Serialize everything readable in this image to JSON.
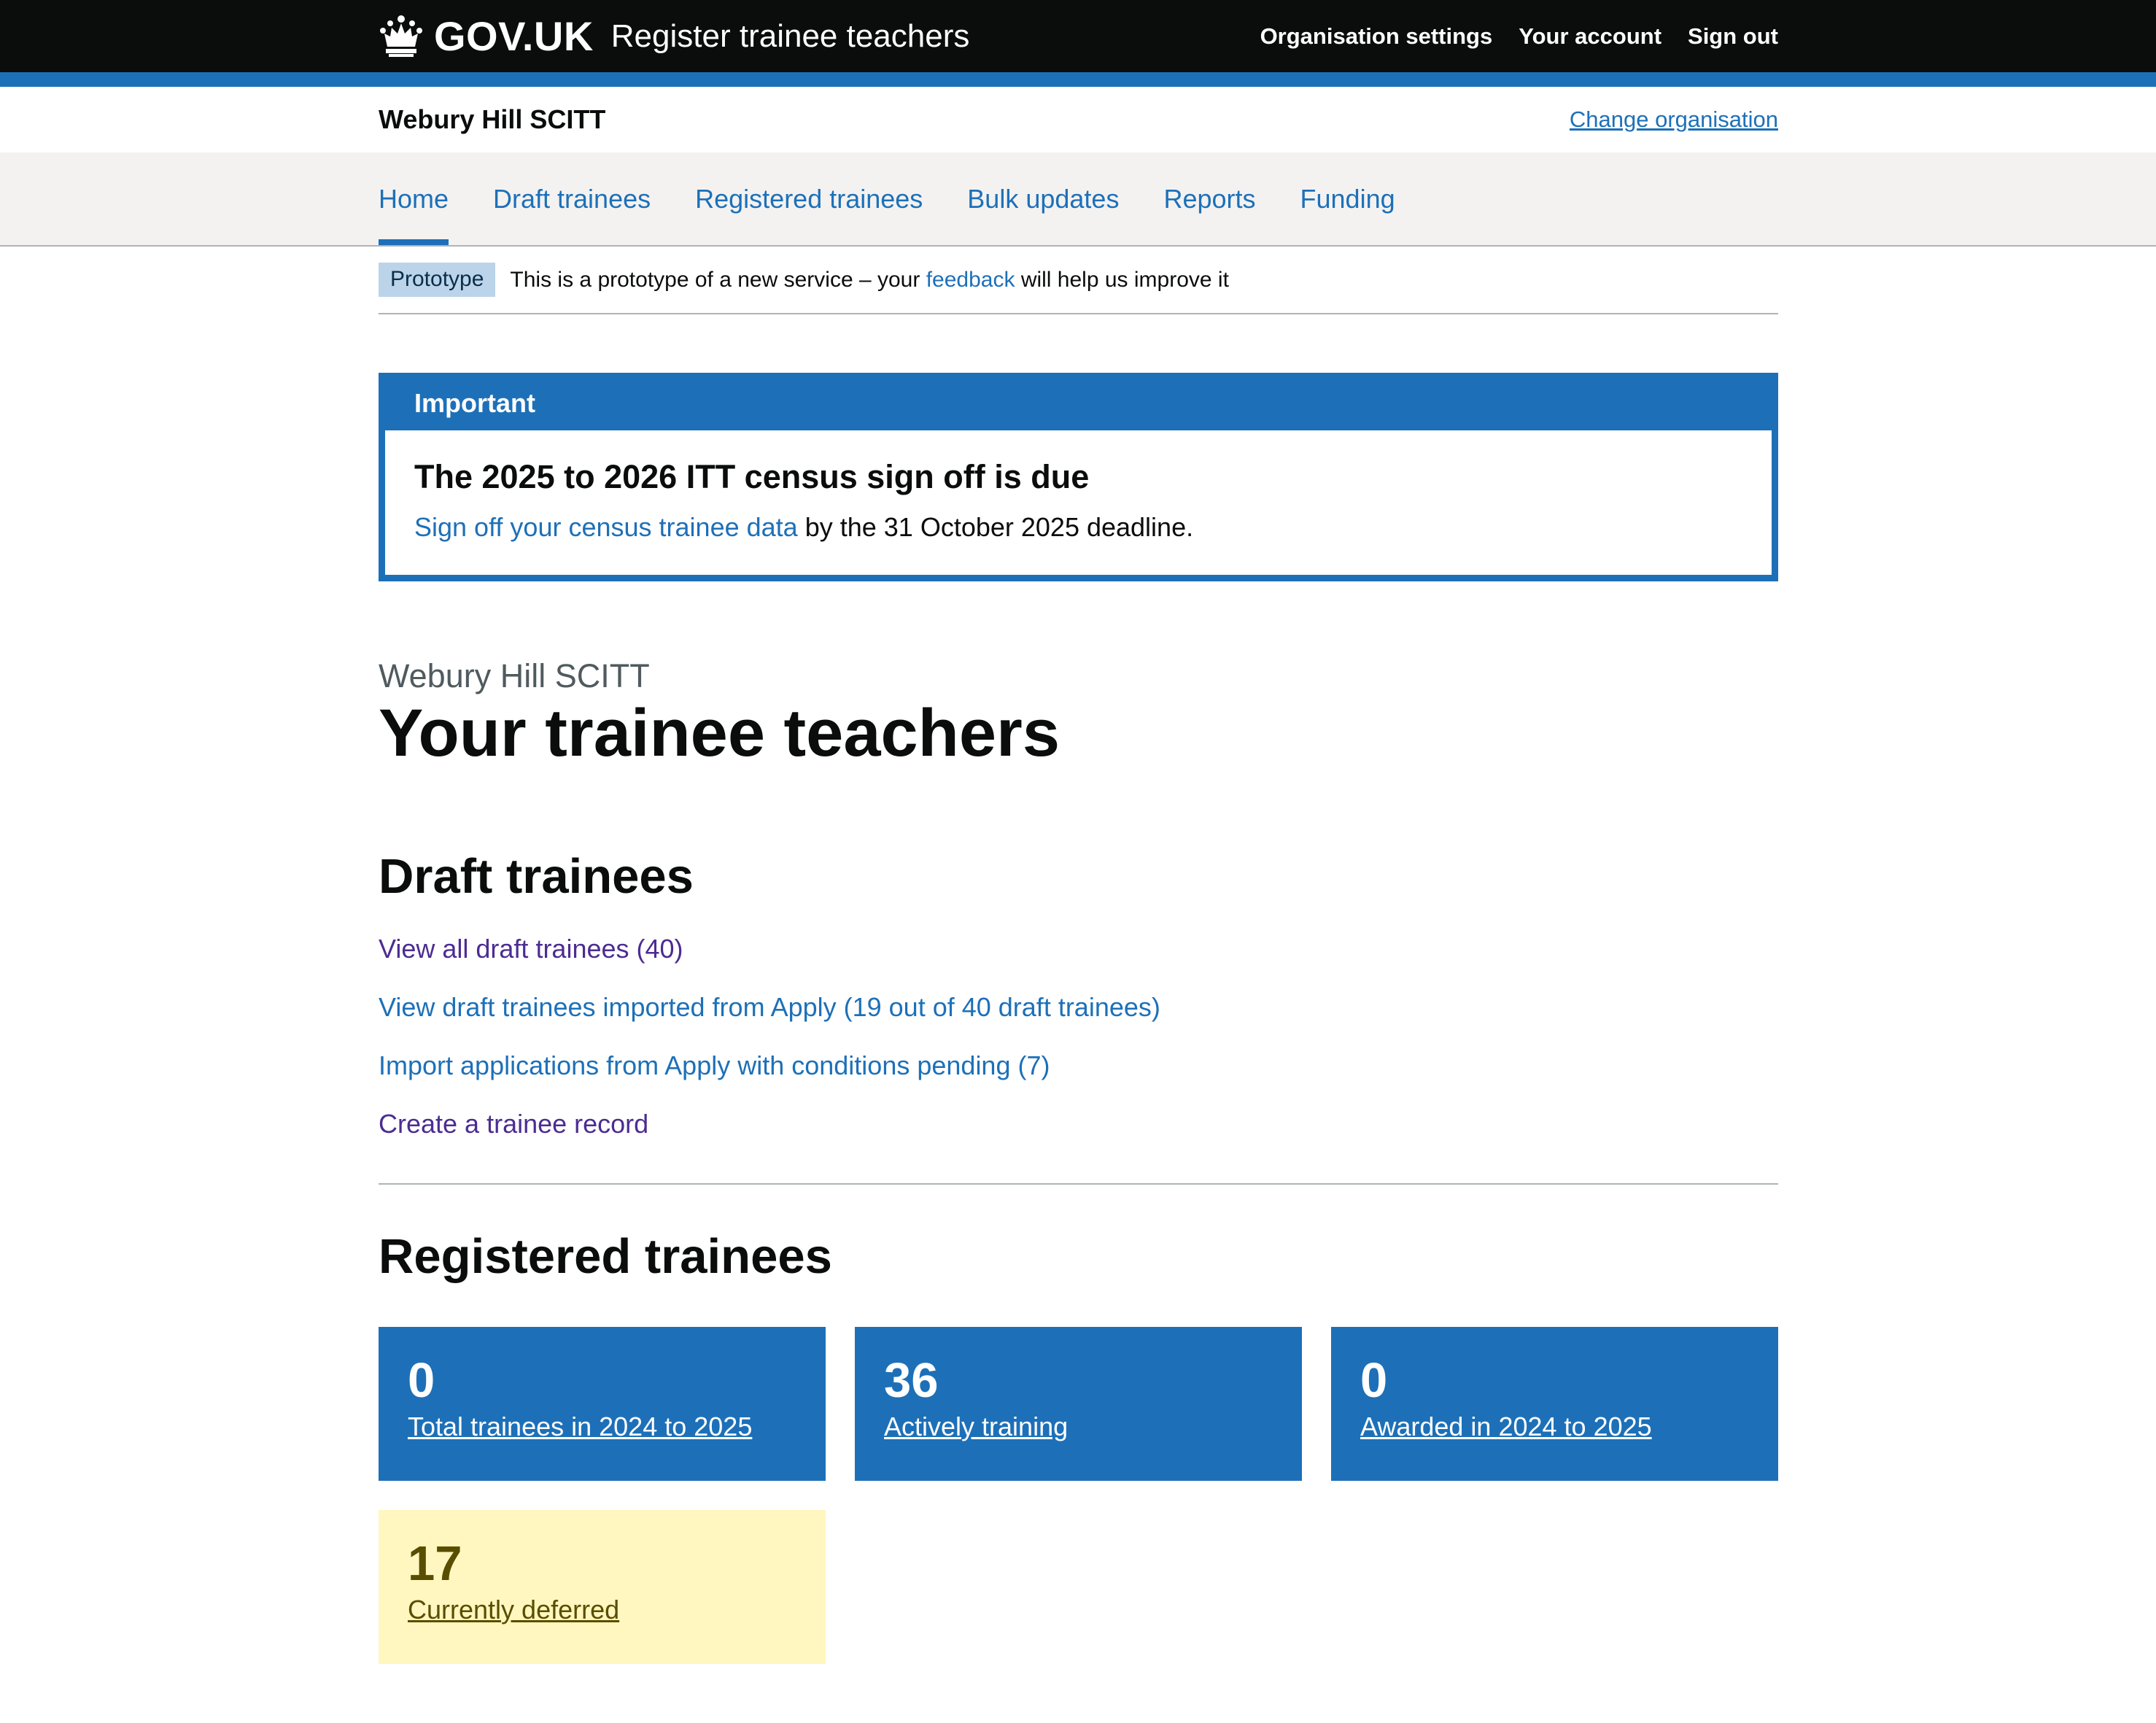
{
  "header": {
    "logotype": "GOV.UK",
    "service_name": "Register trainee teachers",
    "nav": [
      "Organisation settings",
      "Your account",
      "Sign out"
    ]
  },
  "org_bar": {
    "name": "Webury Hill SCITT",
    "change_link": "Change organisation"
  },
  "primary_nav": {
    "items": [
      "Home",
      "Draft trainees",
      "Registered trainees",
      "Bulk updates",
      "Reports",
      "Funding"
    ],
    "current": "Home"
  },
  "phase_banner": {
    "tag": "Prototype",
    "text_before": "This is a prototype of a new service – your",
    "link": "feedback",
    "text_after": "will help us improve it"
  },
  "notification": {
    "title": "Important",
    "heading": "The 2025 to 2026 ITT census sign off is due",
    "link": "Sign off your census trainee data",
    "text_after": "by the 31 October 2025 deadline."
  },
  "page": {
    "caption": "Webury Hill SCITT",
    "title": "Your trainee teachers"
  },
  "draft": {
    "heading": "Draft trainees",
    "links": [
      "View all draft trainees (40)",
      "View draft trainees imported from Apply (19 out of 40 draft trainees)",
      "Import applications from Apply with conditions pending (7)",
      "Create a trainee record"
    ]
  },
  "registered": {
    "heading": "Registered trainees",
    "tiles": [
      {
        "number": "0",
        "label": "Total trainees in 2024 to 2025"
      },
      {
        "number": "36",
        "label": "Actively training"
      },
      {
        "number": "0",
        "label": "Awarded in 2024 to 2025"
      },
      {
        "number": "17",
        "label": "Currently deferred"
      }
    ]
  },
  "colors": {
    "brand_blue": "#1d70b8",
    "header_black": "#0b0c0c",
    "visited_purple": "#4c2c92",
    "deferred_yellow": "#fff7bf"
  }
}
